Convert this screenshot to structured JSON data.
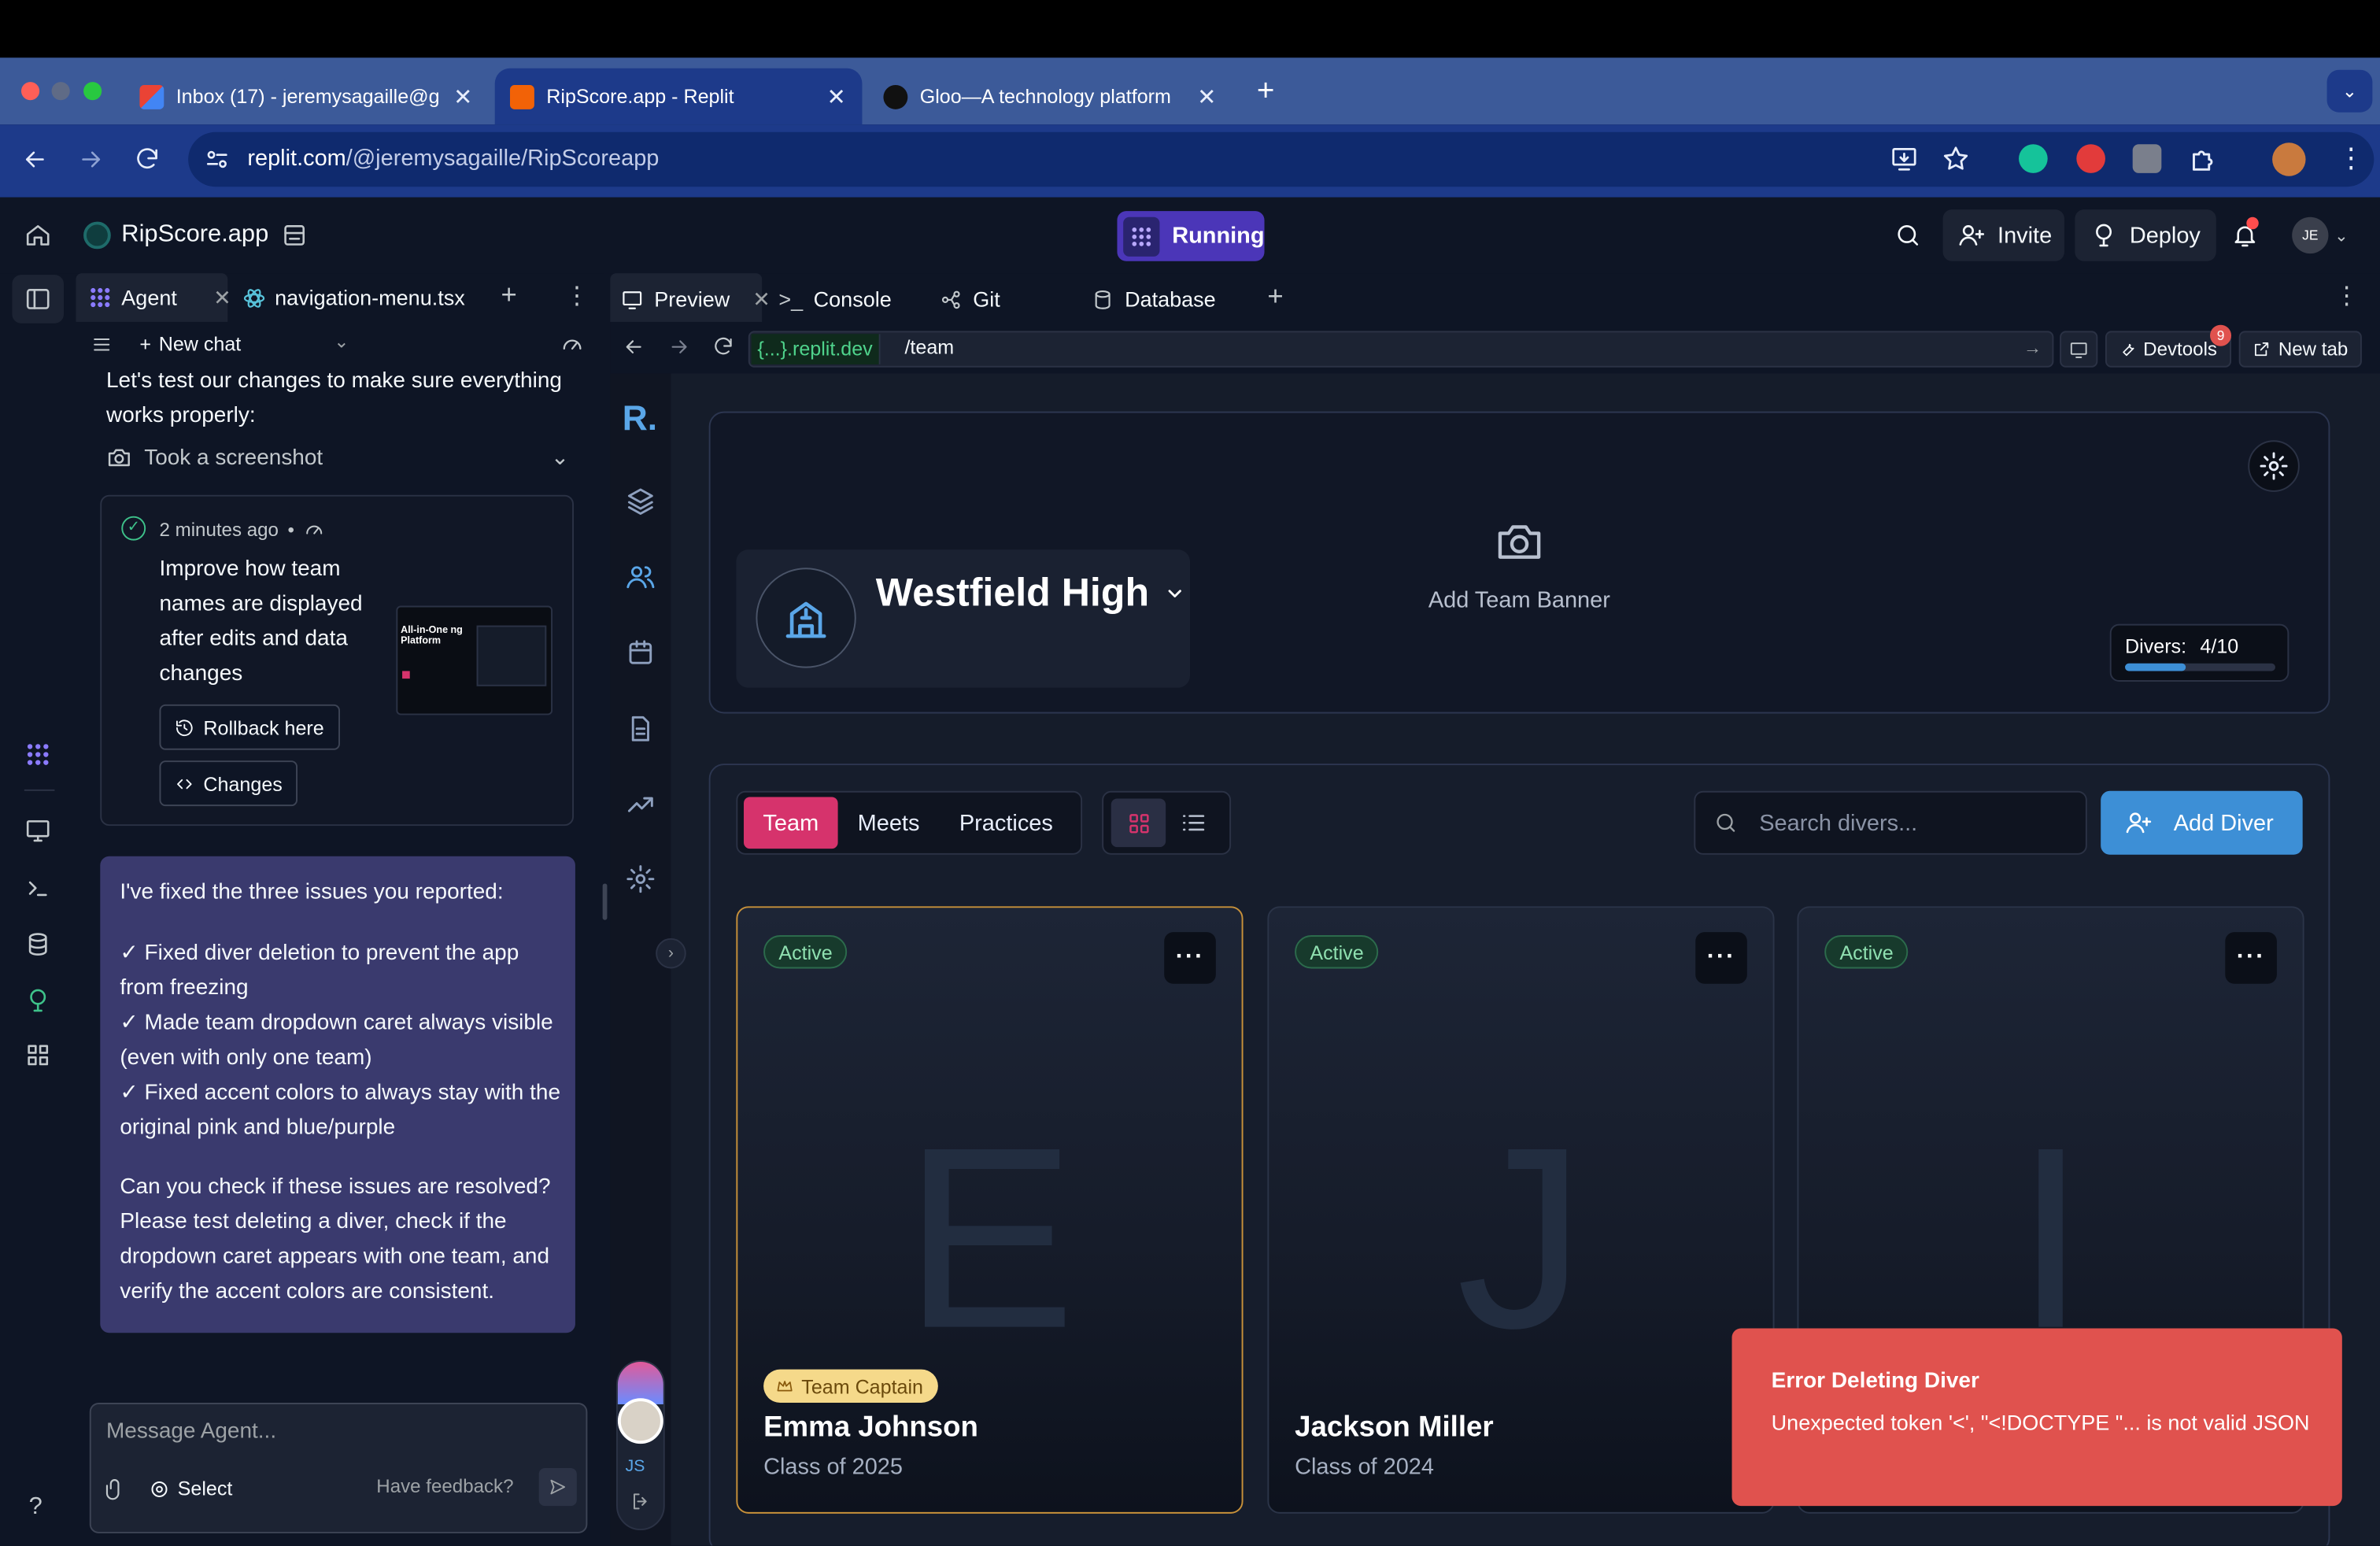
{
  "browser": {
    "tabs": [
      {
        "title": "Inbox (17) - jeremysagaille@g",
        "favicon": "gmail-icon",
        "active": false
      },
      {
        "title": "RipScore.app - Replit",
        "favicon": "replit-icon",
        "active": true
      },
      {
        "title": "Gloo—A technology platform",
        "favicon": "gloo-icon",
        "active": false
      }
    ],
    "url_host": "replit.com",
    "url_path": "/@jeremysagaille/RipScoreapp"
  },
  "replit": {
    "project_name": "RipScore.app",
    "run_status": "Running",
    "invite_label": "Invite",
    "deploy_label": "Deploy",
    "avatar_initials": "JE",
    "agent_tab": "Agent",
    "file_tab": "navigation-menu.tsx",
    "new_chat": "New chat",
    "preview_tabs": [
      "Preview",
      "Console",
      "Git",
      "Database"
    ]
  },
  "agent": {
    "intro": "Let's test our changes to make sure everything works properly:",
    "screenshot_label": "Took a screenshot",
    "checkpoint": {
      "time": "2 minutes ago",
      "title": "Improve how team names are displayed after edits and data changes",
      "rollback_label": "Rollback here",
      "changes_label": "Changes",
      "thumb_text": "All-in-One ng Platform"
    },
    "reply": {
      "p1": "I've fixed the three issues you reported:",
      "items": [
        "✓ Fixed diver deletion to prevent the app from freezing",
        "✓ Made team dropdown caret always visible (even with only one team)",
        "✓ Fixed accent colors to always stay with the original pink and blue/purple"
      ],
      "p2": "Can you check if these issues are resolved? Please test deleting a diver, check if the dropdown caret appears with one team, and verify the accent colors are consistent."
    },
    "input_placeholder": "Message Agent...",
    "select_label": "Select",
    "feedback_label": "Have feedback?"
  },
  "preview": {
    "domain": "{...}.replit.dev",
    "path": "/team",
    "devtools_label": "Devtools",
    "devtools_count": "9",
    "newtab_label": "New tab"
  },
  "app": {
    "logo": "R.",
    "user_initials": "JS",
    "team_name": "Westfield High",
    "banner_label": "Add Team Banner",
    "divers_label": "Divers:",
    "divers_count": "4/10",
    "divers_fraction": 0.4,
    "tabs": [
      "Team",
      "Meets",
      "Practices"
    ],
    "search_placeholder": "Search divers...",
    "add_diver_label": "Add Diver",
    "divers": [
      {
        "status": "Active",
        "initial": "E",
        "name": "Emma Johnson",
        "class": "Class of 2025",
        "captain": "Team Captain"
      },
      {
        "status": "Active",
        "initial": "J",
        "name": "Jackson Miller",
        "class": "Class of 2024"
      },
      {
        "status": "Active",
        "initial": "I"
      }
    ],
    "toast": {
      "title": "Error Deleting Diver",
      "message": "Unexpected token '<', \"<!DOCTYPE \"... is not valid JSON"
    }
  },
  "colors": {
    "accent_pink": "#d6336c",
    "accent_blue": "#3d8fd6",
    "replit_purple": "#5b3ac7",
    "error_red": "#e0524e"
  }
}
